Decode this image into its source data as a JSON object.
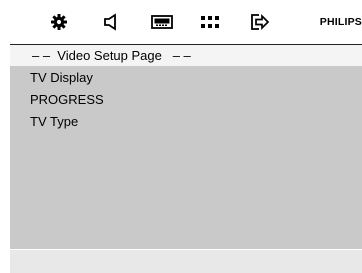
{
  "toolbar": {
    "icons": [
      {
        "name": "general-setup-icon"
      },
      {
        "name": "audio-setup-icon"
      },
      {
        "name": "video-setup-icon"
      },
      {
        "name": "preference-setup-icon"
      },
      {
        "name": "exit-setup-icon"
      }
    ],
    "brand": "PHILIPS"
  },
  "page": {
    "title": "– –  Video Setup Page   – –"
  },
  "menu": {
    "items": [
      {
        "label": "TV Display"
      },
      {
        "label": "PROGRESS"
      },
      {
        "label": "TV Type"
      }
    ]
  },
  "colors": {
    "panel": "#c9c9c9",
    "header": "#f4f4f4",
    "status_bar": "#e8e8e8",
    "text": "#000000"
  }
}
